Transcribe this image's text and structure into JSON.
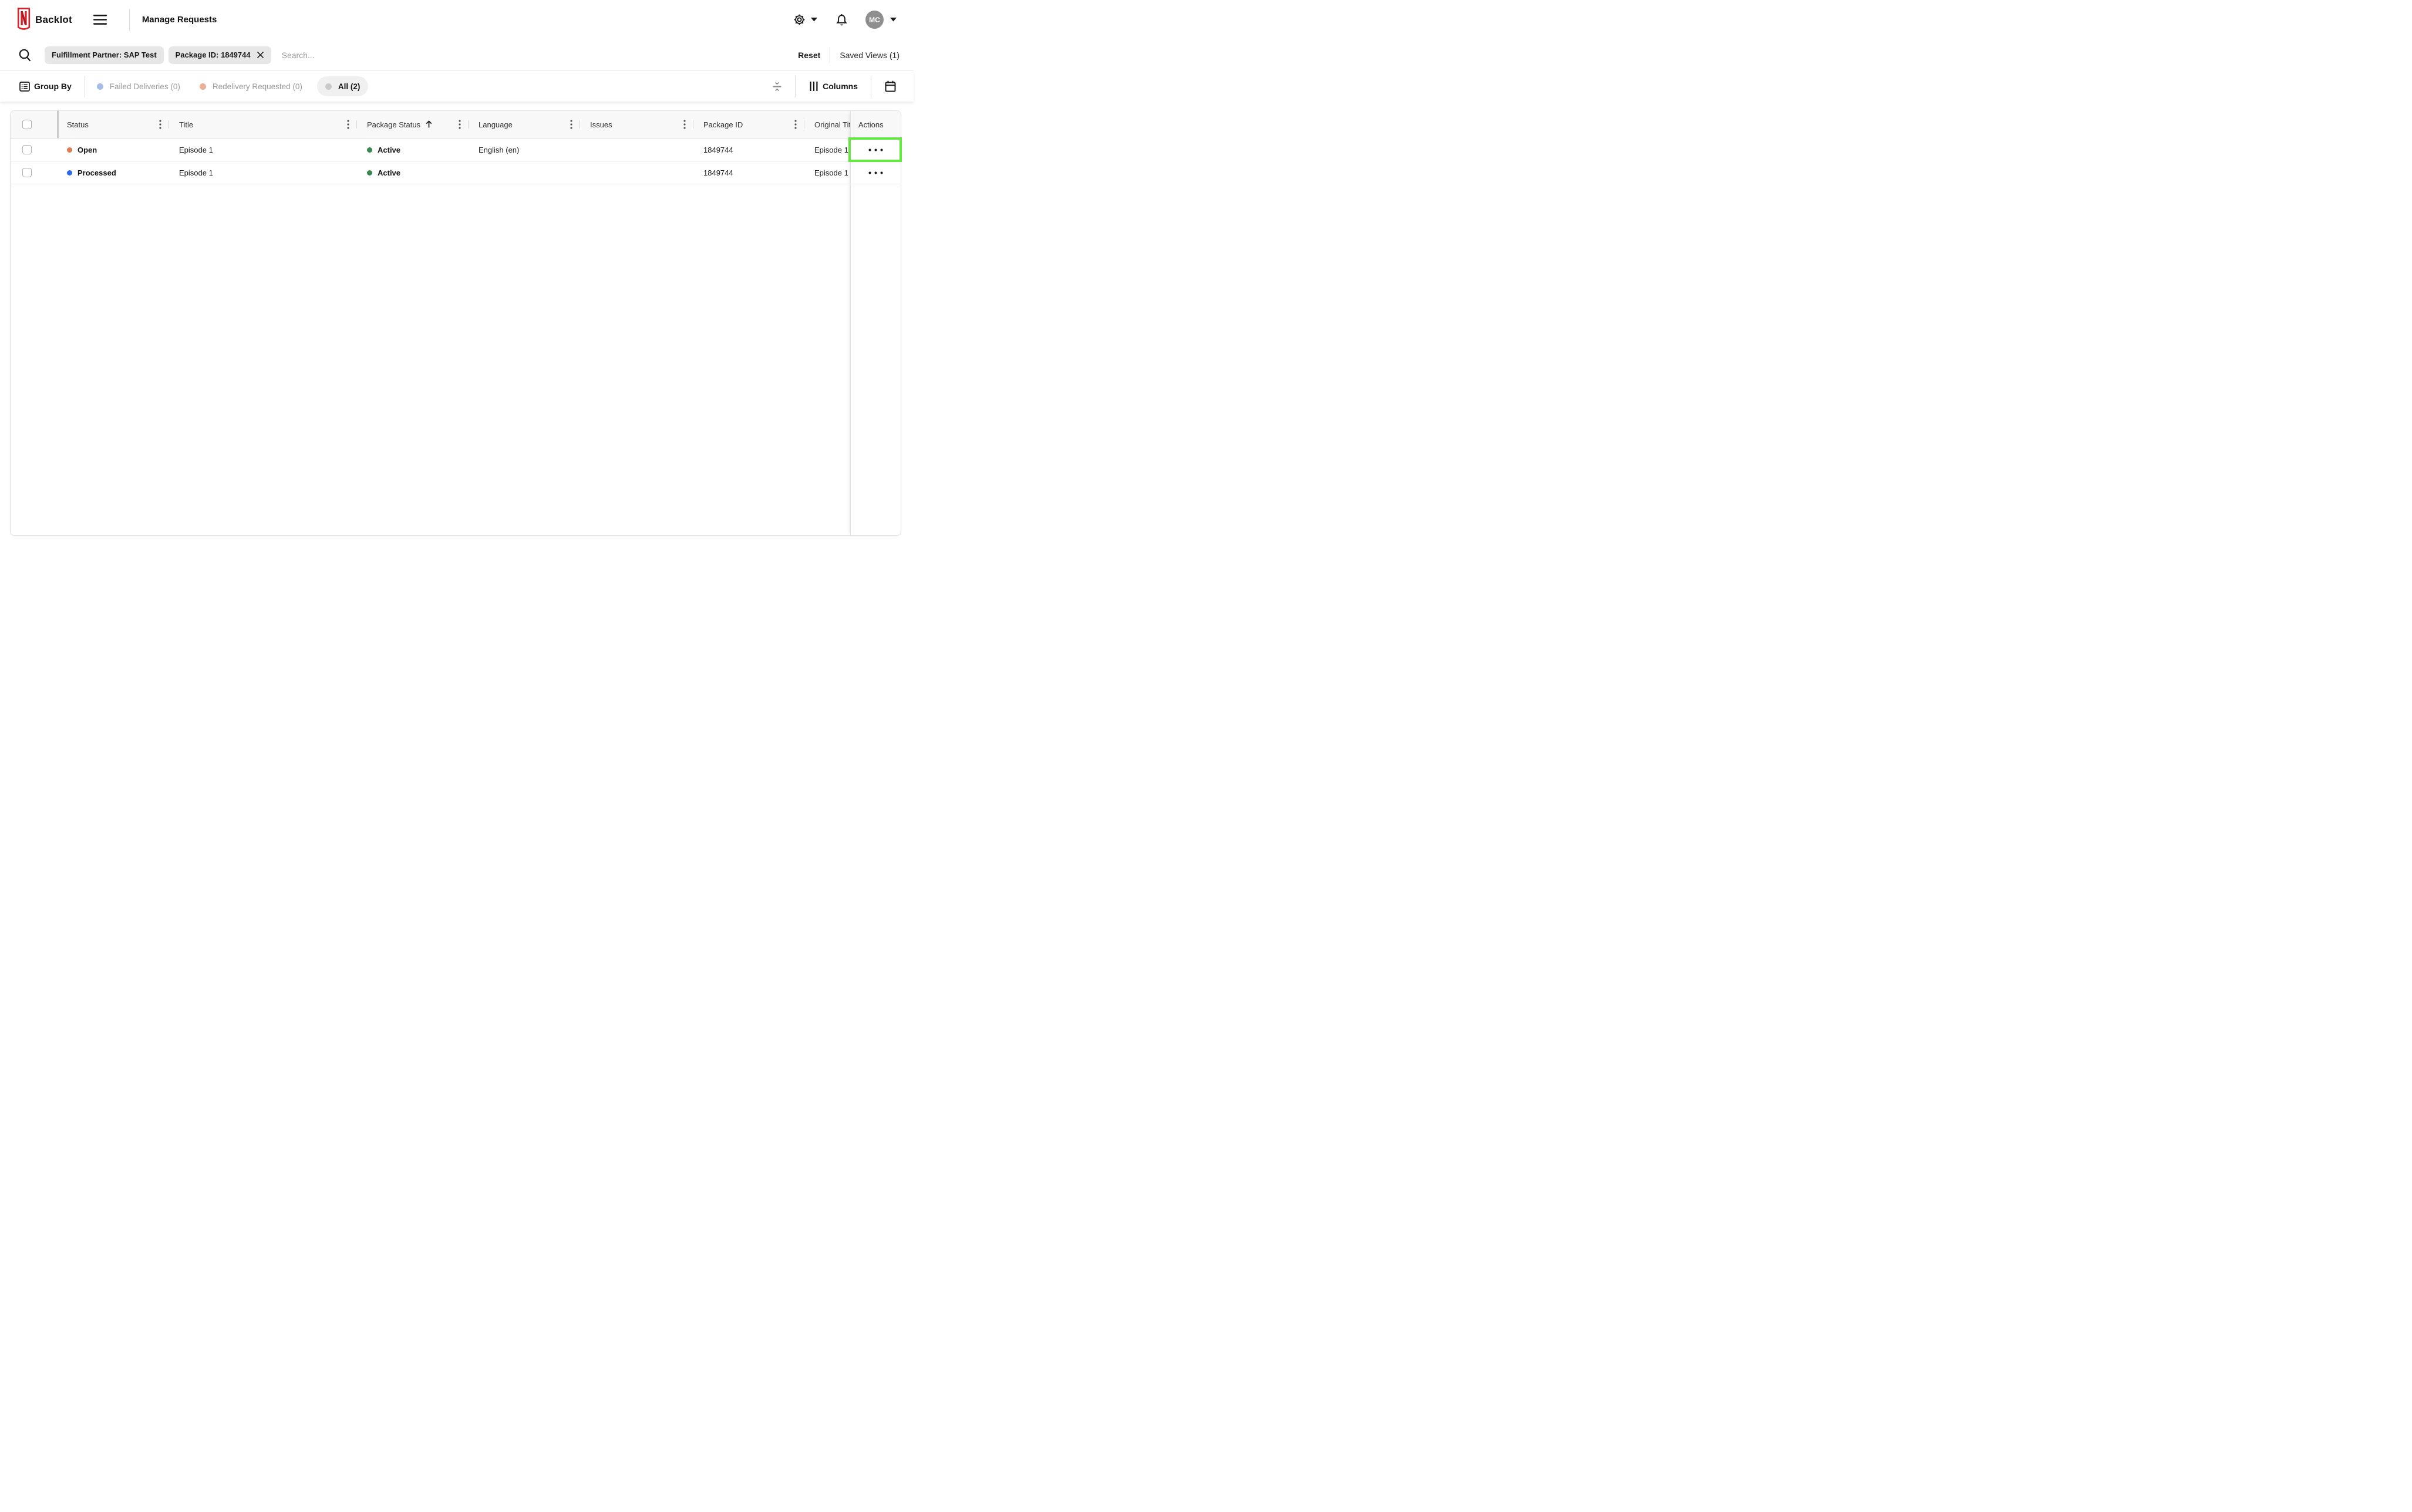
{
  "topbar": {
    "brand": "Backlot",
    "page_title": "Manage Requests",
    "avatar_initials": "MC"
  },
  "filters": {
    "chips": [
      {
        "label": "Fulfillment Partner: SAP Test"
      },
      {
        "label": "Package ID: 1849744"
      }
    ],
    "search_placeholder": "Search...",
    "reset_label": "Reset",
    "saved_views_label": "Saved Views (1)"
  },
  "toolbar": {
    "group_by_label": "Group By",
    "tabs": [
      {
        "label": "Failed Deliveries (0)",
        "dot_color": "#a3bce8",
        "selected": false
      },
      {
        "label": "Redelivery Requested (0)",
        "dot_color": "#ecae94",
        "selected": false
      },
      {
        "label": "All (2)",
        "dot_color": "#c9c9c9",
        "selected": true
      }
    ],
    "columns_label": "Columns"
  },
  "table": {
    "headers": [
      {
        "label": "Status"
      },
      {
        "label": "Title"
      },
      {
        "label": "Package Status",
        "sorted": "asc"
      },
      {
        "label": "Language"
      },
      {
        "label": "Issues"
      },
      {
        "label": "Package ID"
      },
      {
        "label": "Original Tit"
      },
      {
        "label": "Actions"
      }
    ],
    "rows": [
      {
        "status": "Open",
        "status_color": "#dc7b50",
        "title": "Episode 1",
        "package_status": "Active",
        "package_status_color": "#37874f",
        "language": "English (en)",
        "issues": "",
        "package_id": "1849744",
        "original_title": "Episode 1"
      },
      {
        "status": "Processed",
        "status_color": "#2e6be6",
        "title": "Episode 1",
        "package_status": "Active",
        "package_status_color": "#37874f",
        "language": "",
        "issues": "",
        "package_id": "1849744",
        "original_title": "Episode 1"
      }
    ]
  },
  "highlight": {
    "border_color": "#62e93f"
  },
  "brand_color": "#d3232b"
}
